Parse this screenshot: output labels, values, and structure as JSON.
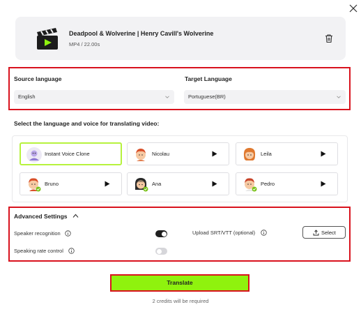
{
  "file": {
    "title": "Deadpool & Wolverine | Henry Cavill's Wolverine",
    "meta": "MP4 / 22.00s"
  },
  "source_language": {
    "label": "Source language",
    "value": "English"
  },
  "target_language": {
    "label": "Target Language",
    "value": "Portuguese(BR)"
  },
  "voice_section": {
    "heading": "Select the language and voice for translating video:",
    "voices": [
      {
        "name": "Instant Voice Clone",
        "selected": true
      },
      {
        "name": "Nicolau"
      },
      {
        "name": "Leila"
      },
      {
        "name": "Bruno",
        "premium": true
      },
      {
        "name": "Ana",
        "premium": true
      },
      {
        "name": "Pedro",
        "premium": true
      }
    ]
  },
  "advanced": {
    "title": "Advanced Settings",
    "speaker_recognition": {
      "label": "Speaker recognition",
      "on": true
    },
    "speaking_rate": {
      "label": "Speaking rate control",
      "on": false
    },
    "upload_label": "Upload SRT/VTT (optional)",
    "select_label": "Select"
  },
  "translate_label": "Translate",
  "credits_note": "2 credits will be required",
  "colors": {
    "accent": "#8ff20e",
    "highlight_border": "#d9121d",
    "selected_border": "#b6f23d",
    "card_bg": "#f2f2f4"
  }
}
